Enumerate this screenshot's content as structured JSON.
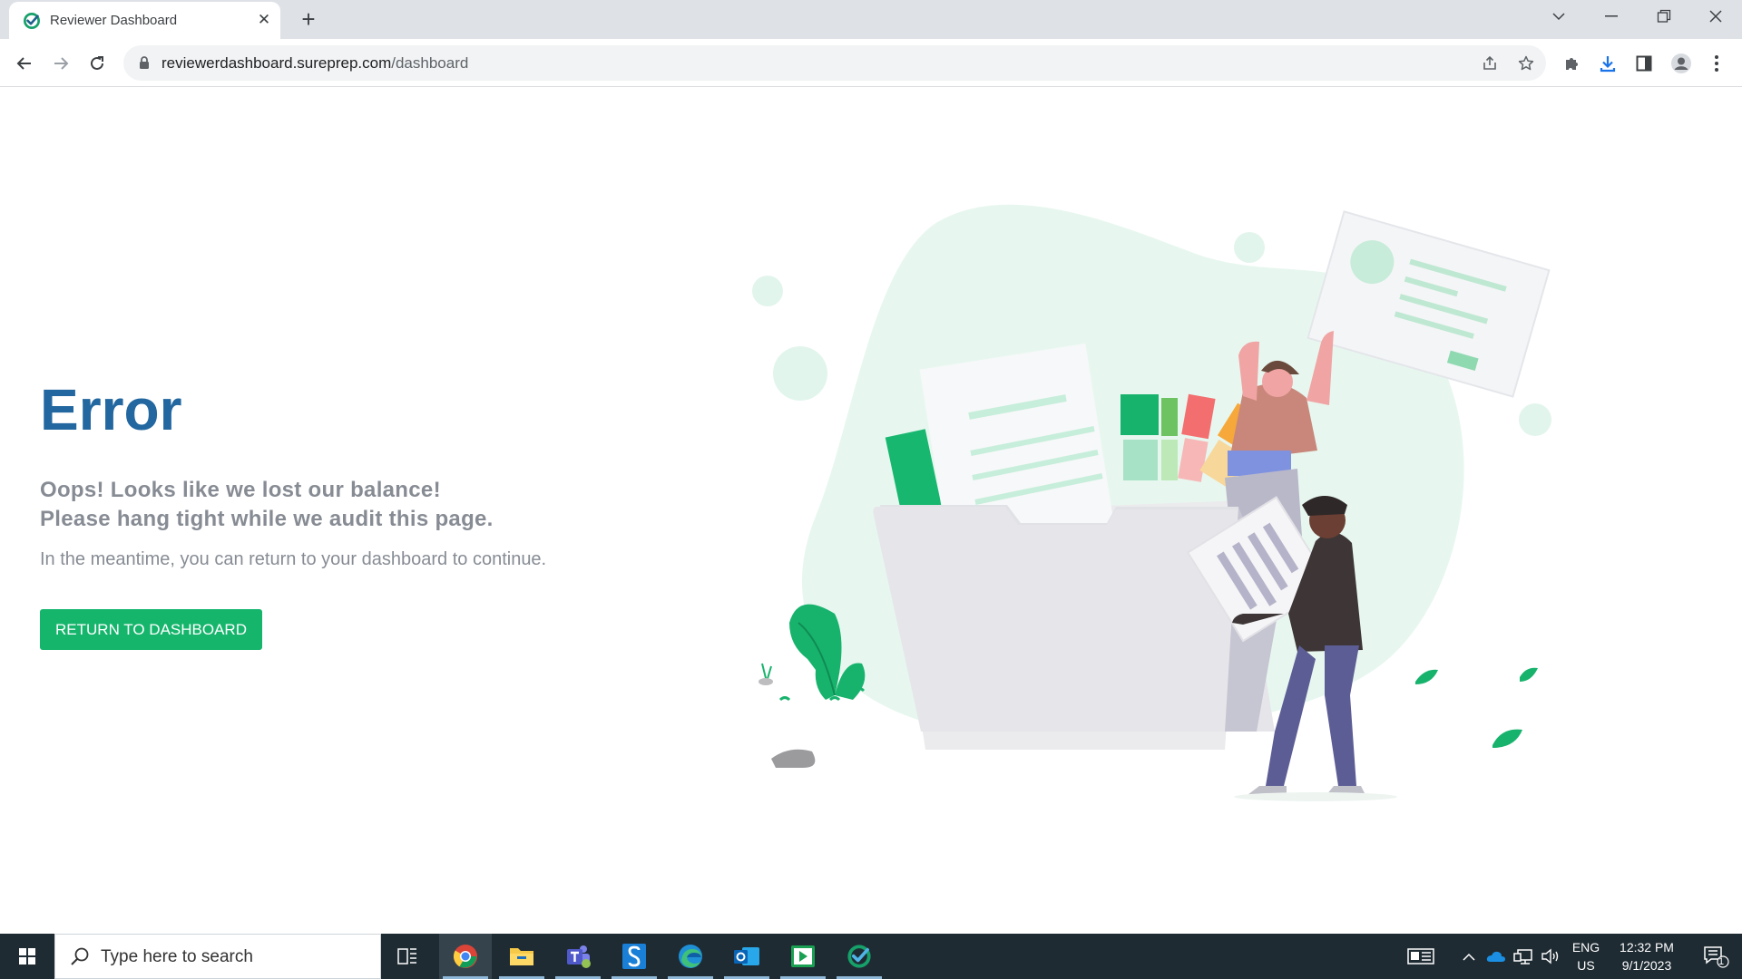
{
  "browser": {
    "tab_title": "Reviewer Dashboard",
    "url_domain": "reviewerdashboard.sureprep.com",
    "url_path": "/dashboard",
    "accent_color": "#15b56c"
  },
  "page": {
    "title": "Error",
    "subtitle_line1": "Oops! Looks like we lost our balance!",
    "subtitle_line2": "Please hang tight while we audit this page.",
    "description": "In the meantime, you can return to your dashboard to continue.",
    "button_label": "RETURN TO DASHBOARD",
    "title_color": "#22679f",
    "button_color": "#15b56c"
  },
  "taskbar": {
    "search_placeholder": "Type here to search",
    "apps": [
      "task-view",
      "chrome",
      "file-explorer",
      "teams",
      "sureprep",
      "edge",
      "outlook",
      "player",
      "reviewer"
    ],
    "lang_line1": "ENG",
    "lang_line2": "US",
    "time": "12:32 PM",
    "date": "9/1/2023",
    "notification_count": "1"
  }
}
